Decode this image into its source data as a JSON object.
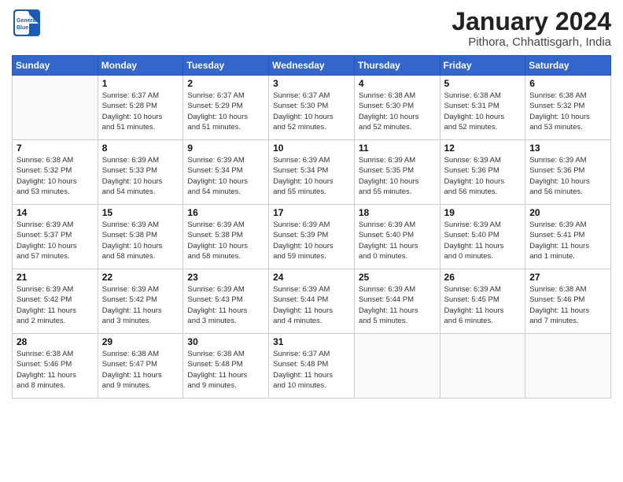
{
  "header": {
    "logo_line1": "General",
    "logo_line2": "Blue",
    "month": "January 2024",
    "location": "Pithora, Chhattisgarh, India"
  },
  "weekdays": [
    "Sunday",
    "Monday",
    "Tuesday",
    "Wednesday",
    "Thursday",
    "Friday",
    "Saturday"
  ],
  "weeks": [
    [
      {
        "num": "",
        "info": ""
      },
      {
        "num": "1",
        "info": "Sunrise: 6:37 AM\nSunset: 5:28 PM\nDaylight: 10 hours\nand 51 minutes."
      },
      {
        "num": "2",
        "info": "Sunrise: 6:37 AM\nSunset: 5:29 PM\nDaylight: 10 hours\nand 51 minutes."
      },
      {
        "num": "3",
        "info": "Sunrise: 6:37 AM\nSunset: 5:30 PM\nDaylight: 10 hours\nand 52 minutes."
      },
      {
        "num": "4",
        "info": "Sunrise: 6:38 AM\nSunset: 5:30 PM\nDaylight: 10 hours\nand 52 minutes."
      },
      {
        "num": "5",
        "info": "Sunrise: 6:38 AM\nSunset: 5:31 PM\nDaylight: 10 hours\nand 52 minutes."
      },
      {
        "num": "6",
        "info": "Sunrise: 6:38 AM\nSunset: 5:32 PM\nDaylight: 10 hours\nand 53 minutes."
      }
    ],
    [
      {
        "num": "7",
        "info": "Sunrise: 6:38 AM\nSunset: 5:32 PM\nDaylight: 10 hours\nand 53 minutes."
      },
      {
        "num": "8",
        "info": "Sunrise: 6:39 AM\nSunset: 5:33 PM\nDaylight: 10 hours\nand 54 minutes."
      },
      {
        "num": "9",
        "info": "Sunrise: 6:39 AM\nSunset: 5:34 PM\nDaylight: 10 hours\nand 54 minutes."
      },
      {
        "num": "10",
        "info": "Sunrise: 6:39 AM\nSunset: 5:34 PM\nDaylight: 10 hours\nand 55 minutes."
      },
      {
        "num": "11",
        "info": "Sunrise: 6:39 AM\nSunset: 5:35 PM\nDaylight: 10 hours\nand 55 minutes."
      },
      {
        "num": "12",
        "info": "Sunrise: 6:39 AM\nSunset: 5:36 PM\nDaylight: 10 hours\nand 56 minutes."
      },
      {
        "num": "13",
        "info": "Sunrise: 6:39 AM\nSunset: 5:36 PM\nDaylight: 10 hours\nand 56 minutes."
      }
    ],
    [
      {
        "num": "14",
        "info": "Sunrise: 6:39 AM\nSunset: 5:37 PM\nDaylight: 10 hours\nand 57 minutes."
      },
      {
        "num": "15",
        "info": "Sunrise: 6:39 AM\nSunset: 5:38 PM\nDaylight: 10 hours\nand 58 minutes."
      },
      {
        "num": "16",
        "info": "Sunrise: 6:39 AM\nSunset: 5:38 PM\nDaylight: 10 hours\nand 58 minutes."
      },
      {
        "num": "17",
        "info": "Sunrise: 6:39 AM\nSunset: 5:39 PM\nDaylight: 10 hours\nand 59 minutes."
      },
      {
        "num": "18",
        "info": "Sunrise: 6:39 AM\nSunset: 5:40 PM\nDaylight: 11 hours\nand 0 minutes."
      },
      {
        "num": "19",
        "info": "Sunrise: 6:39 AM\nSunset: 5:40 PM\nDaylight: 11 hours\nand 0 minutes."
      },
      {
        "num": "20",
        "info": "Sunrise: 6:39 AM\nSunset: 5:41 PM\nDaylight: 11 hours\nand 1 minute."
      }
    ],
    [
      {
        "num": "21",
        "info": "Sunrise: 6:39 AM\nSunset: 5:42 PM\nDaylight: 11 hours\nand 2 minutes."
      },
      {
        "num": "22",
        "info": "Sunrise: 6:39 AM\nSunset: 5:42 PM\nDaylight: 11 hours\nand 3 minutes."
      },
      {
        "num": "23",
        "info": "Sunrise: 6:39 AM\nSunset: 5:43 PM\nDaylight: 11 hours\nand 3 minutes."
      },
      {
        "num": "24",
        "info": "Sunrise: 6:39 AM\nSunset: 5:44 PM\nDaylight: 11 hours\nand 4 minutes."
      },
      {
        "num": "25",
        "info": "Sunrise: 6:39 AM\nSunset: 5:44 PM\nDaylight: 11 hours\nand 5 minutes."
      },
      {
        "num": "26",
        "info": "Sunrise: 6:39 AM\nSunset: 5:45 PM\nDaylight: 11 hours\nand 6 minutes."
      },
      {
        "num": "27",
        "info": "Sunrise: 6:38 AM\nSunset: 5:46 PM\nDaylight: 11 hours\nand 7 minutes."
      }
    ],
    [
      {
        "num": "28",
        "info": "Sunrise: 6:38 AM\nSunset: 5:46 PM\nDaylight: 11 hours\nand 8 minutes."
      },
      {
        "num": "29",
        "info": "Sunrise: 6:38 AM\nSunset: 5:47 PM\nDaylight: 11 hours\nand 9 minutes."
      },
      {
        "num": "30",
        "info": "Sunrise: 6:38 AM\nSunset: 5:48 PM\nDaylight: 11 hours\nand 9 minutes."
      },
      {
        "num": "31",
        "info": "Sunrise: 6:37 AM\nSunset: 5:48 PM\nDaylight: 11 hours\nand 10 minutes."
      },
      {
        "num": "",
        "info": ""
      },
      {
        "num": "",
        "info": ""
      },
      {
        "num": "",
        "info": ""
      }
    ]
  ]
}
